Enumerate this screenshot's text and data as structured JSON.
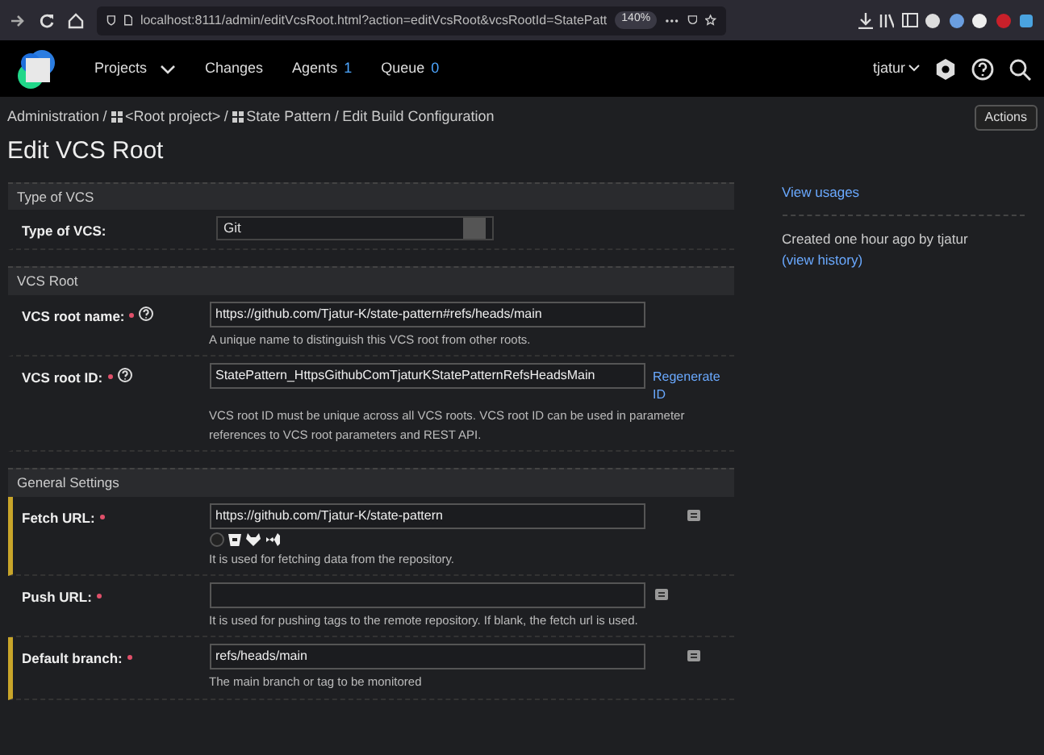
{
  "browser": {
    "url": "localhost:8111/admin/editVcsRoot.html?action=editVcsRoot&vcsRootId=StatePatt",
    "zoom": "140%"
  },
  "header": {
    "nav": [
      {
        "label": "Projects",
        "dropdown": true
      },
      {
        "label": "Changes",
        "dropdown": false
      },
      {
        "label": "Agents",
        "count": "1",
        "dropdown": false
      },
      {
        "label": "Queue",
        "count": "0",
        "dropdown": false
      }
    ],
    "user": "tjatur"
  },
  "breadcrumb_separators": [
    "/",
    "/",
    "/"
  ],
  "breadcrumbs": [
    {
      "label": "Administration",
      "kind": "plain"
    },
    {
      "label": "<Root project>",
      "kind": "project"
    },
    {
      "label": "State Pattern",
      "kind": "project"
    },
    {
      "label": "Edit Build Configuration",
      "kind": "plain"
    }
  ],
  "actions_button": "Actions",
  "title": "Edit VCS Root",
  "sections": [
    {
      "title": "Type of VCS",
      "rows": [
        {
          "label": "Type of VCS:",
          "kind": "select",
          "value": "Git",
          "required": false,
          "help": false,
          "highlighted": false
        }
      ]
    },
    {
      "title": "VCS Root",
      "rows": [
        {
          "label": "VCS root name:",
          "kind": "text",
          "value": "https://github.com/Tjatur-K/state-pattern#refs/heads/main",
          "required": true,
          "help": true,
          "highlighted": false,
          "note": "A unique name to distinguish this VCS root from other roots."
        },
        {
          "label": "VCS root ID:",
          "kind": "text",
          "value": "StatePattern_HttpsGithubComTjaturKStatePatternRefsHeadsMain",
          "required": true,
          "help": true,
          "highlighted": false,
          "link": "Regenerate ID",
          "note": "VCS root ID must be unique across all VCS roots. VCS root ID can be used in parameter references to VCS root parameters and REST API."
        }
      ]
    },
    {
      "title": "General Settings",
      "rows": [
        {
          "label": "Fetch URL:",
          "kind": "text",
          "value": "https://github.com/Tjatur-K/state-pattern",
          "required": true,
          "help": false,
          "highlighted": true,
          "hosts": true,
          "side_icon": true,
          "note": "It is used for fetching data from the repository."
        },
        {
          "label": "Push URL:",
          "kind": "text",
          "required": true,
          "help": false,
          "highlighted": false,
          "side_icon": true,
          "note": "It is used for pushing tags to the remote repository. If blank, the fetch url is used."
        },
        {
          "label": "Default branch:",
          "kind": "text",
          "value": "refs/heads/main",
          "required": true,
          "help": false,
          "highlighted": true,
          "side_icon": true,
          "note": "The main branch or tag to be monitored"
        }
      ]
    }
  ],
  "sidebar": {
    "link": "View usages",
    "created": "Created one hour ago by tjatur",
    "history": "(view history)"
  }
}
